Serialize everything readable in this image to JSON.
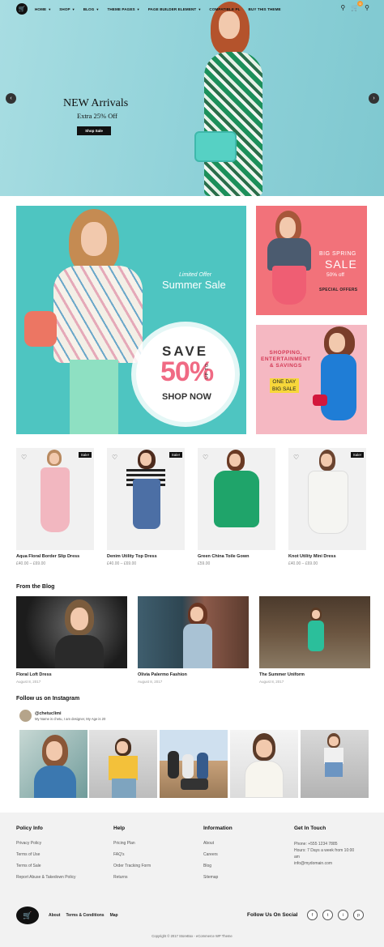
{
  "nav": {
    "items": [
      {
        "label": "HOME",
        "dropdown": true
      },
      {
        "label": "SHOP",
        "dropdown": true
      },
      {
        "label": "BLOG",
        "dropdown": true
      },
      {
        "label": "THEME PAGES",
        "dropdown": true
      },
      {
        "label": "PAGE BUILDER ELEMENT",
        "dropdown": true
      },
      {
        "label": "COMPATIBLE PL",
        "dropdown": false
      },
      {
        "label": "BUY THIS THEME",
        "dropdown": false
      }
    ],
    "cart_count": "0",
    "icons": [
      "user-icon",
      "cart-icon",
      "search-icon"
    ]
  },
  "hero": {
    "title": "NEW Arrivals",
    "subtitle": "Extra 25% Off",
    "button": "Shop Sale",
    "prev": "‹",
    "next": "›"
  },
  "promo": {
    "main": {
      "limited": "Limited Offer",
      "title": "Summer Sale",
      "save": "SAVE",
      "percent": "50%",
      "upto": "UP TO",
      "shop_now": "SHOP NOW"
    },
    "spring": {
      "line1": "BIG SPRING",
      "line2": "SALE",
      "line3": "50% off",
      "line4": "SPECIAL OFFERS"
    },
    "shopping": {
      "line1": "SHOPPING,",
      "line2": "ENTERTAINMENT",
      "line3": "& SAVINGS",
      "line4": "ONE DAY",
      "line5": "BIG SALE"
    }
  },
  "products": [
    {
      "name": "Aqua Floral Border Slip Dress",
      "price": "£40.00 – £69.00",
      "badge": "Sale!",
      "dress_color": "#f2b7c0"
    },
    {
      "name": "Denim Utility Top Dress",
      "price": "£40.00 – £69.00",
      "badge": "Sale!",
      "dress_color": "#4c6fa5"
    },
    {
      "name": "Green China Toile Gown",
      "price": "£59.00",
      "badge": "",
      "dress_color": "#1fa46a"
    },
    {
      "name": "Knot Utility Mini Dress",
      "price": "£40.00 – £69.00",
      "badge": "Sale!",
      "dress_color": "#f5f5f2"
    }
  ],
  "blog": {
    "heading": "From the Blog",
    "posts": [
      {
        "title": "Floral Loft Dress",
        "date": "August 8, 2017"
      },
      {
        "title": "Olivia Palermo Fashion",
        "date": "August 8, 2017"
      },
      {
        "title": "The Summer Uniform",
        "date": "August 8, 2017"
      }
    ]
  },
  "instagram": {
    "heading": "Follow us on Instagram",
    "username": "@chetuclimi",
    "bio": "My Name is chetu, I am designer, My Age is 20"
  },
  "footer": {
    "policy": {
      "heading": "Policy Info",
      "links": [
        "Privacy Policy",
        "Terms of Use",
        "Terms of Sale",
        "Report Abuse & Takedown Policy"
      ]
    },
    "help": {
      "heading": "Help",
      "links": [
        "Pricing Plan",
        "FAQ's",
        "Order Tracking Form",
        "Returns"
      ]
    },
    "information": {
      "heading": "Information",
      "links": [
        "About",
        "Careers",
        "Blog",
        "Sitemap"
      ]
    },
    "contact": {
      "heading": "Get In Touch",
      "phone": "Phone: +555 1234 7885",
      "hours1": "Hours: 7 Days a week from 10:00",
      "hours2": "am",
      "email": "info@mydomain.com"
    },
    "bottom_links": [
      "About",
      "Terms & Conditions",
      "Map"
    ],
    "follow": "Follow Us On Social",
    "socials": [
      "f",
      "t",
      "i",
      "p"
    ],
    "copyright": "Copyright © 2017 StoreBox - eCommerce WP Theme"
  }
}
